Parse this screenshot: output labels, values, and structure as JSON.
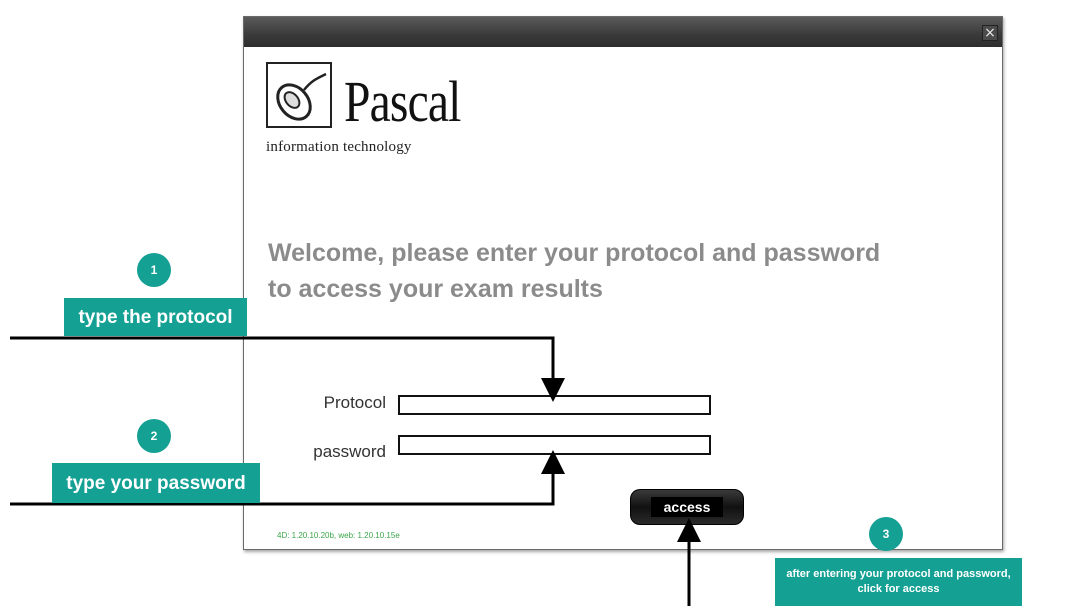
{
  "window": {
    "close_glyph": "×"
  },
  "logo": {
    "name": "Pascal",
    "tagline": "information technology"
  },
  "welcome": "Welcome, please enter your protocol and password to access your exam results",
  "form": {
    "protocol_label": "Protocol",
    "protocol_value": "",
    "password_label": "password",
    "password_value": "",
    "access_label": "access"
  },
  "version": "4D: 1.20.10.20b, web: 1.20.10.15e",
  "tutorial": {
    "step1": {
      "number": "1",
      "text": "type the protocol"
    },
    "step2": {
      "number": "2",
      "text": "type your password"
    },
    "step3": {
      "number": "3",
      "text": "after entering your protocol and password, click for access"
    }
  },
  "colors": {
    "accent": "#15a094",
    "titlebar": "#3a3a3a",
    "heading": "#8b8b8b"
  }
}
